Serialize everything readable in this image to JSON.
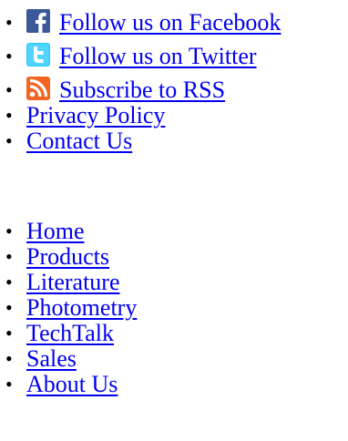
{
  "social": {
    "items": [
      {
        "label": "Follow us on Facebook",
        "icon": "facebook-icon",
        "color": "#3b5998"
      },
      {
        "label": "Follow us on Twitter",
        "icon": "twitter-icon",
        "color": "#33ccff"
      },
      {
        "label": "Subscribe to RSS",
        "icon": "rss-icon",
        "color": "#f26522"
      },
      {
        "label": "Privacy Policy"
      },
      {
        "label": "Contact Us"
      }
    ]
  },
  "nav": {
    "items": [
      {
        "label": "Home"
      },
      {
        "label": "Products"
      },
      {
        "label": "Literature"
      },
      {
        "label": "Photometry"
      },
      {
        "label": "TechTalk"
      },
      {
        "label": "Sales"
      },
      {
        "label": "About Us"
      }
    ]
  },
  "colors": {
    "link": "#0000ee",
    "bullet": "#000000"
  }
}
